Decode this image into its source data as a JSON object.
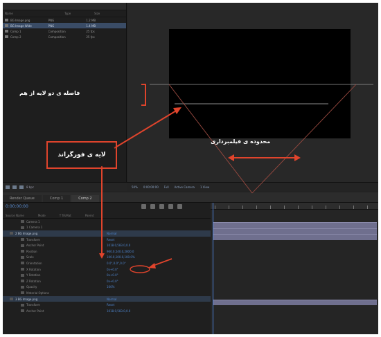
{
  "project_panel": {
    "columns": [
      "Name",
      "",
      "Type",
      "Size",
      ""
    ],
    "items": [
      {
        "name": "BG Image.png",
        "type": "PNG",
        "size": "1.2 MB"
      },
      {
        "name": "BG Image Wide",
        "type": "PNG",
        "size": "1.4 MB"
      },
      {
        "name": "Comp 1",
        "type": "Composition",
        "size": "25 fps"
      },
      {
        "name": "Comp 2",
        "type": "Composition",
        "size": "25 fps"
      }
    ],
    "footer_label": "8 bpc"
  },
  "viewer": {
    "zoom": "50%",
    "timecode": "0:00:00:00",
    "resolution": "Full",
    "camera": "Active Camera",
    "view": "1 View"
  },
  "timeline": {
    "tabs": [
      "Render Queue",
      "Comp 1",
      "Comp 2"
    ],
    "active_tab_index": 2,
    "timecode": "0:00:00:00",
    "column_headers": [
      "Source Name",
      "Mode",
      "T TrkMat",
      "Parent"
    ],
    "rows": [
      {
        "name": "Camera 1",
        "value": "",
        "hi": false
      },
      {
        "name": "1  Camera 1",
        "value": "",
        "hi": false
      },
      {
        "name": "2  BG Image.png",
        "value": "Normal",
        "hi": true
      },
      {
        "name": "Transform",
        "value": "Reset",
        "hi": false
      },
      {
        "name": "Anchor Point",
        "value": "1018.0,583.0,0.0",
        "hi": false
      },
      {
        "name": "Position",
        "value": "960.0,540.0,2800.0",
        "hi": false
      },
      {
        "name": "Scale",
        "value": "100.0,100.0,100.0%",
        "hi": false
      },
      {
        "name": "Orientation",
        "value": "0.0°,0.0°,0.0°",
        "hi": false
      },
      {
        "name": "X Rotation",
        "value": "0x+0.0°",
        "hi": false
      },
      {
        "name": "Y Rotation",
        "value": "0x+0.0°",
        "hi": false
      },
      {
        "name": "Z Rotation",
        "value": "0x+0.0°",
        "hi": false
      },
      {
        "name": "Opacity",
        "value": "100%",
        "hi": false
      },
      {
        "name": "Material Options",
        "value": "",
        "hi": false
      },
      {
        "name": "3  BG Image.png",
        "value": "Normal",
        "hi": true
      },
      {
        "name": "Transform",
        "value": "Reset",
        "hi": false
      },
      {
        "name": "Anchor Point",
        "value": "1018.0,583.0,0.0",
        "hi": false
      }
    ]
  },
  "annotations": {
    "layer_distance": "فاصله ی دو لایه از هم",
    "foreground_layer": "لایه ی فورگراند",
    "camera_range": "محدوده ی فیلمبرداری"
  },
  "colors": {
    "accent_red": "#e0442c",
    "panel_dark": "#232323",
    "value_blue": "#4f86cf"
  }
}
